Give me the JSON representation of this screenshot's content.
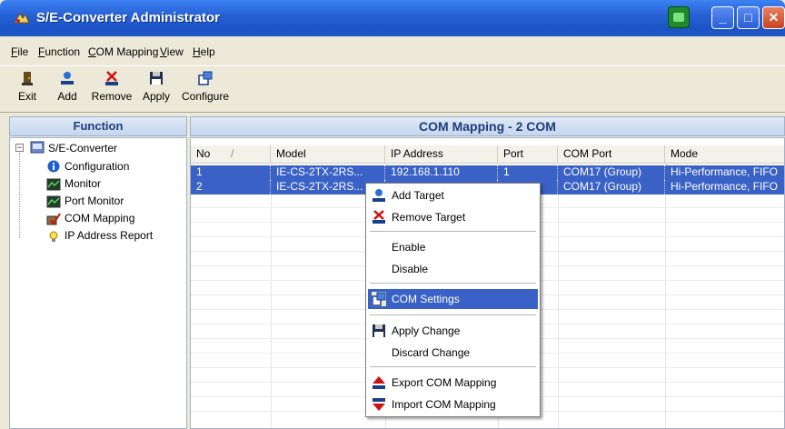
{
  "window": {
    "title": "S/E-Converter Administrator",
    "controls": [
      "minimize",
      "maximize",
      "close"
    ]
  },
  "menu": {
    "items": [
      {
        "label": "File"
      },
      {
        "label": "Function"
      },
      {
        "label": "COM Mapping"
      },
      {
        "label": "View"
      },
      {
        "label": "Help"
      }
    ]
  },
  "toolbar": {
    "buttons": [
      {
        "label": "Exit",
        "icon": "exit-icon"
      },
      {
        "label": "Add",
        "icon": "add-icon"
      },
      {
        "label": "Remove",
        "icon": "remove-icon"
      },
      {
        "label": "Apply",
        "icon": "floppy-disk-icon"
      },
      {
        "label": "Configure",
        "icon": "configure-icon"
      }
    ]
  },
  "function_panel": {
    "header": "Function",
    "tree": {
      "root": "S/E-Converter",
      "children": [
        {
          "label": "Configuration",
          "icon": "info-icon"
        },
        {
          "label": "Monitor",
          "icon": "monitor-icon"
        },
        {
          "label": "Port Monitor",
          "icon": "port-monitor-icon"
        },
        {
          "label": "COM Mapping",
          "icon": "com-mapping-icon"
        },
        {
          "label": "IP Address Report",
          "icon": "lightbulb-icon"
        }
      ]
    }
  },
  "mapping_panel": {
    "header": "COM Mapping - 2 COM",
    "columns": [
      "No",
      "Model",
      "IP Address",
      "Port",
      "COM Port",
      "Mode"
    ],
    "sort_indicator": "/",
    "rows": [
      {
        "no": "1",
        "model": "IE-CS-2TX-2RS...",
        "ip": "192.168.1.110",
        "port": "1",
        "com_port": "COM17 (Group)",
        "mode": "Hi-Performance, FIFO"
      },
      {
        "no": "2",
        "model": "IE-CS-2TX-2RS...",
        "ip": "",
        "port": "",
        "com_port": "COM17 (Group)",
        "mode": "Hi-Performance, FIFO"
      }
    ]
  },
  "context_menu": {
    "items": [
      {
        "label": "Add Target",
        "icon": "add-target-icon"
      },
      {
        "label": "Remove Target",
        "icon": "remove-target-icon"
      },
      {
        "label": "Enable"
      },
      {
        "label": "Disable"
      },
      {
        "label": "COM Settings",
        "icon": "com-settings-icon",
        "highlighted": true
      },
      {
        "label": "Apply Change",
        "icon": "floppy-disk-icon"
      },
      {
        "label": "Discard Change"
      },
      {
        "label": "Export COM Mapping",
        "icon": "export-icon"
      },
      {
        "label": "Import COM Mapping",
        "icon": "import-icon"
      }
    ]
  },
  "colors": {
    "titlebar": "#2762d6",
    "selection": "#3a61c6",
    "panel_header_text": "#1d3d7b"
  }
}
